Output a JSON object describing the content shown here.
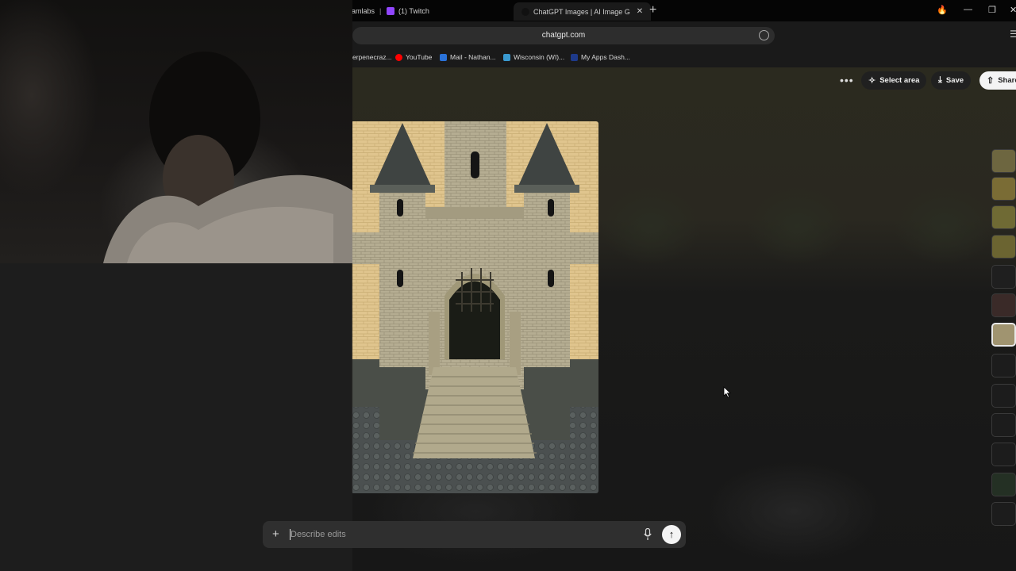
{
  "browser": {
    "tabs": [
      {
        "label": "amlabs"
      },
      {
        "label": "(1) Twitch"
      },
      {
        "label": "ChatGPT Images | AI Image G",
        "active": true
      }
    ],
    "address": "chatgpt.com",
    "bookmarks": [
      {
        "label": "erpenecraz..."
      },
      {
        "label": "YouTube"
      },
      {
        "label": "Mail - Nathan..."
      },
      {
        "label": "Wisconsin (WI)..."
      },
      {
        "label": "My Apps Dash..."
      }
    ]
  },
  "actions": {
    "select_area": "Select area",
    "save": "Save",
    "share": "Share"
  },
  "composer": {
    "placeholder": "Describe edits"
  },
  "colors": {
    "accent_light": "#f4f4f4",
    "page_bg": "#131313",
    "twitch": "#9146ff",
    "youtube": "#ff0000"
  }
}
